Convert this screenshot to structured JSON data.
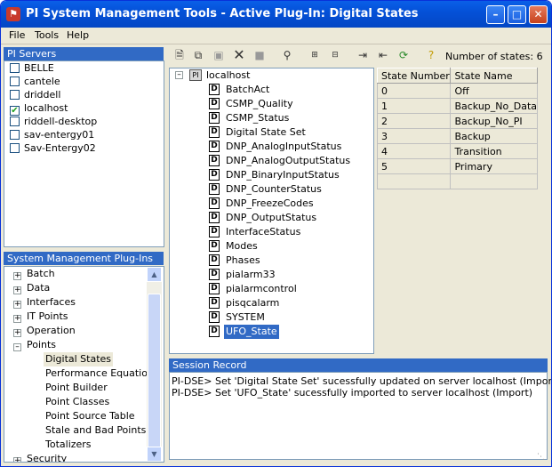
{
  "window": {
    "title": "PI System Management Tools - Active Plug-In: Digital States",
    "icon_text": "⚑"
  },
  "menu": {
    "items": [
      "File",
      "Tools",
      "Help"
    ]
  },
  "servers_panel": {
    "header": "PI Servers",
    "items": [
      {
        "label": "BELLE",
        "checked": false
      },
      {
        "label": "cantele",
        "checked": false
      },
      {
        "label": "driddell",
        "checked": false
      },
      {
        "label": "localhost",
        "checked": true
      },
      {
        "label": "riddell-desktop",
        "checked": false
      },
      {
        "label": "sav-entergy01",
        "checked": false
      },
      {
        "label": "Sav-Entergy02",
        "checked": false
      }
    ]
  },
  "plugins_panel": {
    "header": "System Management Plug-Ins",
    "items": [
      {
        "label": "Batch",
        "toggle": "+"
      },
      {
        "label": "Data",
        "toggle": "+"
      },
      {
        "label": "Interfaces",
        "toggle": "+"
      },
      {
        "label": "IT Points",
        "toggle": "+"
      },
      {
        "label": "Operation",
        "toggle": "+"
      },
      {
        "label": "Points",
        "toggle": "-"
      },
      {
        "label": "Digital States",
        "child": true,
        "selected": true
      },
      {
        "label": "Performance Equations",
        "child": true
      },
      {
        "label": "Point Builder",
        "child": true
      },
      {
        "label": "Point Classes",
        "child": true
      },
      {
        "label": "Point Source Table",
        "child": true
      },
      {
        "label": "Stale and Bad Points",
        "child": true
      },
      {
        "label": "Totalizers",
        "child": true
      },
      {
        "label": "Security",
        "toggle": "+"
      }
    ]
  },
  "toolbar": {
    "icons": [
      "new-icon",
      "copy-icon",
      "paste-icon",
      "delete-icon",
      "stop-icon",
      "find-icon",
      "expand-icon",
      "collapse-icon",
      "export-icon",
      "import-icon",
      "refresh-icon",
      "help-icon"
    ],
    "state_count_label": "Number of states: 6"
  },
  "tree": {
    "root": "localhost",
    "items": [
      "BatchAct",
      "CSMP_Quality",
      "CSMP_Status",
      "Digital State Set",
      "DNP_AnalogInputStatus",
      "DNP_AnalogOutputStatus",
      "DNP_BinaryInputStatus",
      "DNP_CounterStatus",
      "DNP_FreezeCodes",
      "DNP_OutputStatus",
      "InterfaceStatus",
      "Modes",
      "Phases",
      "pialarm33",
      "pialarmcontrol",
      "pisqcalarm",
      "SYSTEM",
      "UFO_State"
    ],
    "selected": "UFO_State"
  },
  "state_table": {
    "headers": [
      "State Number",
      "State Name"
    ],
    "rows": [
      [
        "0",
        "Off"
      ],
      [
        "1",
        "Backup_No_Data"
      ],
      [
        "2",
        "Backup_No_PI"
      ],
      [
        "3",
        "Backup"
      ],
      [
        "4",
        "Transition"
      ],
      [
        "5",
        "Primary"
      ]
    ]
  },
  "session": {
    "header": "Session Record",
    "lines": [
      "PI-DSE> Set 'Digital State Set' sucessfully updated on server localhost (Import)",
      "PI-DSE> Set 'UFO_State' sucessfully imported to server localhost (Import)"
    ]
  }
}
